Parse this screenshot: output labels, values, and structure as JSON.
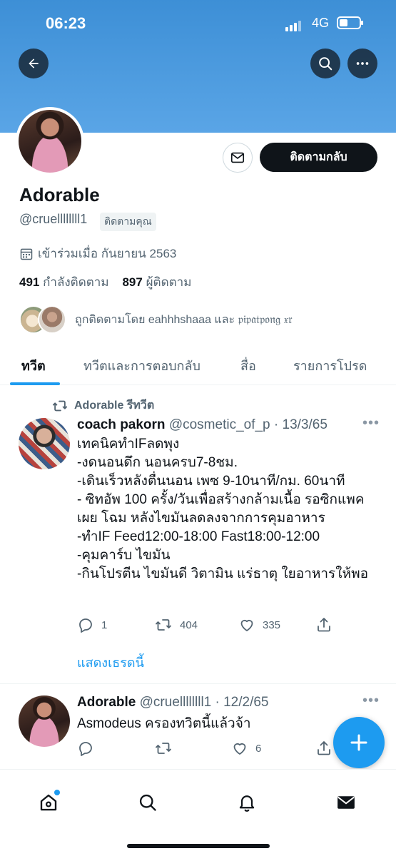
{
  "status_bar": {
    "time": "06:23",
    "network": "4G"
  },
  "profile": {
    "name": "Adorable",
    "handle": "@cruellllllll1",
    "follows_you": "ติดตามคุณ",
    "joined": "เข้าร่วมเมื่อ กันยายน 2563",
    "following_count": "491",
    "following_label": "กำลังติดตาม",
    "followers_count": "897",
    "followers_label": "ผู้ติดตาม",
    "followed_by": "ถูกติดตามโดย eahhhshaaa และ 𝔭𝔦𝔭𝔞𝔱𝔭𝔬𝔫𝔤 𝔵𝔯",
    "follow_button": "ติดตามกลับ"
  },
  "tabs": [
    {
      "label": "ทวีต",
      "active": true
    },
    {
      "label": "ทวีตและการตอบกลับ",
      "active": false
    },
    {
      "label": "สื่อ",
      "active": false
    },
    {
      "label": "รายการโปรด",
      "active": false
    }
  ],
  "tweets": [
    {
      "retweet_label": "Adorable รีทวีต",
      "author_name": "coach pakorn",
      "author_handle": "@cosmetic_of_p · 13/3/65",
      "text": "เทคนิคทำIFลดพุง\n-งดนอนดึก นอนครบ7-8ชม.\n-เดินเร็วหลังตื่นนอน เพซ 9-10นาที/กม. 60นาที\n- ซิทอัพ 100 ครั้ง/วันเพื่อสร้างกล้ามเนื้อ รอซิกแพคเผย โฉม หลังไขมันลดลงจากการคุมอาหาร\n-ทำIF Feed12:00-18:00 Fast18:00-12:00\n-คุมคาร์บ ไขมัน\n-กินโปรตีน ไขมันดี วิตามิน แร่ธาตุ ใยอาหารให้พอ",
      "replies": "1",
      "retweets": "404",
      "likes": "335",
      "show_thread": "แสดงเธรดนี้"
    },
    {
      "author_name": "Adorable",
      "author_handle": "@cruellllllll1 · 12/2/65",
      "text": "Asmodeus ครองทวิตนี้แล้วจ้า",
      "replies": "",
      "retweets": "",
      "likes": "6"
    }
  ],
  "colors": {
    "accent": "#1d9bf0",
    "banner": "#4a9ae0",
    "text": "#0f1419",
    "muted": "#536471"
  },
  "icons": [
    "back-arrow-icon",
    "search-icon",
    "more-icon",
    "mail-icon",
    "calendar-icon",
    "retweet-icon",
    "reply-icon",
    "like-icon",
    "share-icon",
    "compose-icon",
    "home-icon",
    "explore-icon",
    "bell-icon",
    "inbox-icon"
  ]
}
